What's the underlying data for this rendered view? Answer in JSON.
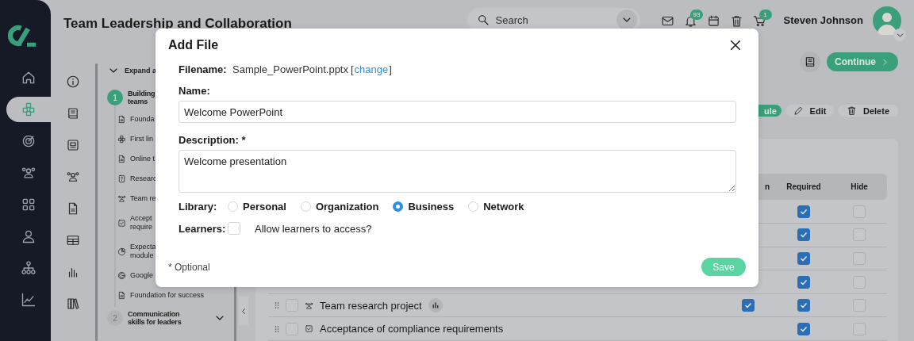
{
  "app": {
    "title": "Team Leadership and Collaboration"
  },
  "search": {
    "placeholder": "Search"
  },
  "header": {
    "notifications_badge": "93",
    "cart_badge": "1",
    "user_name": "Steven Johnson"
  },
  "nav_rail": [
    {
      "selected": false
    },
    {
      "selected": true
    },
    {
      "selected": false
    },
    {
      "selected": false
    },
    {
      "selected": false
    },
    {
      "selected": false
    },
    {
      "selected": false
    },
    {
      "selected": false
    }
  ],
  "outline": {
    "expand_label": "Expand a",
    "steps": [
      {
        "number": "1",
        "active": true,
        "lines": [
          "Building",
          "teams"
        ],
        "expanded": true,
        "items": [
          {
            "lines": [
              "Founda"
            ]
          },
          {
            "lines": [
              "First lin"
            ]
          },
          {
            "lines": [
              "Online t"
            ]
          },
          {
            "lines": [
              "Researc"
            ]
          },
          {
            "lines": [
              "Team re"
            ]
          },
          {
            "lines": [
              "Accept",
              "require"
            ]
          },
          {
            "lines": [
              "Expecta",
              "module"
            ]
          },
          {
            "lines": [
              "Google"
            ]
          },
          {
            "lines": [
              "Foundation for success"
            ]
          }
        ]
      },
      {
        "number": "2",
        "active": false,
        "lines": [
          "Communication",
          "skills for leaders"
        ],
        "expanded": false
      }
    ]
  },
  "actions": {
    "continue": "Continue",
    "partial_button": "ule",
    "edit": "Edit",
    "delete": "Delete"
  },
  "table": {
    "columns": [
      "n",
      "Required",
      "Hide"
    ],
    "rows": [
      {
        "required": true,
        "hide": false
      },
      {
        "required": true,
        "hide": false
      },
      {
        "required": true,
        "hide": false
      },
      {
        "required": true,
        "hide": false
      },
      {
        "name": "Team research project",
        "checked": false,
        "first_checked": true,
        "required": true,
        "hide": false
      },
      {
        "name": "Acceptance of compliance requirements",
        "checked": false,
        "required": true,
        "hide": false
      }
    ]
  },
  "modal": {
    "title": "Add File",
    "filename_label": "Filename:",
    "filename": "Sample_PowerPoint.pptx",
    "bracket_open": "[",
    "change_link": "change",
    "bracket_close": "]",
    "name_label": "Name:",
    "name_value": "Welcome PowerPoint",
    "description_label": "Description: *",
    "description_value": "Welcome presentation",
    "library_label": "Library:",
    "library_options": [
      {
        "label": "Personal",
        "selected": false
      },
      {
        "label": "Organization",
        "selected": false
      },
      {
        "label": "Business",
        "selected": true
      },
      {
        "label": "Network",
        "selected": false
      }
    ],
    "learners_label": "Learners:",
    "learners_checked": false,
    "learners_text": "Allow learners to access?",
    "footnote": "* Optional",
    "save": "Save"
  }
}
